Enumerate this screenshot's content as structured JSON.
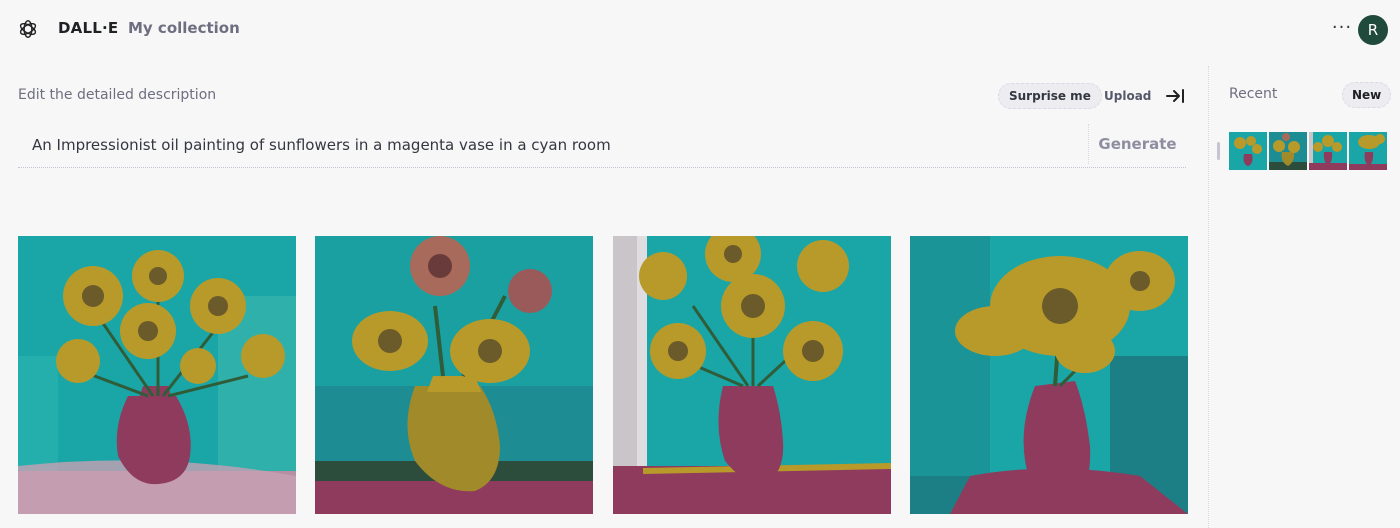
{
  "header": {
    "brand": "DALL·E",
    "nav_link": "My collection",
    "more_icon": "more-horizontal-icon",
    "more_glyph": "···",
    "avatar_initial": "R"
  },
  "prompt": {
    "label": "Edit the detailed description",
    "surprise_label": "Surprise me",
    "upload_label": "Upload",
    "collapse_icon": "collapse-right-icon",
    "text": "An Impressionist oil painting of sunflowers in a magenta vase in a cyan room",
    "generate_label": "Generate"
  },
  "results": {
    "images": [
      "sunflowers-painting-1",
      "sunflowers-painting-2",
      "sunflowers-painting-3",
      "sunflowers-painting-4"
    ]
  },
  "sidebar": {
    "recent_label": "Recent",
    "new_label": "New",
    "thumbnails": [
      "recent-1",
      "recent-2",
      "recent-3",
      "recent-4"
    ]
  },
  "colors": {
    "cyan": "#1aa6a6",
    "teal_dark": "#1d7f86",
    "magenta": "#8e3b5e",
    "mustard": "#b89a2a",
    "avatar": "#1f4a3c"
  }
}
